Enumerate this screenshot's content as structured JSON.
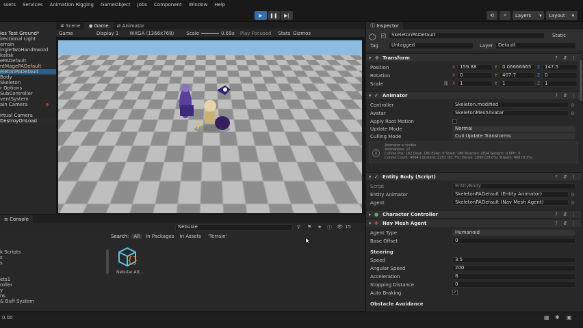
{
  "menu": [
    "ssets",
    "Services",
    "Animation Rigging",
    "GameObject",
    "Jobs",
    "Component",
    "Window",
    "Help"
  ],
  "toolbar": {
    "layers": "Layers",
    "layout": "Layout"
  },
  "scene_tabs": {
    "scene": "Scene",
    "game": "Game",
    "animator": "Animator"
  },
  "game_bar": {
    "mode": "Game",
    "display": "Display 1",
    "resolution": "WXGA (1366x768)",
    "scale_label": "Scale",
    "scale_value": "0.69x",
    "play_focused": "Play Focused",
    "stats": "Stats",
    "gizmos": "Gizmos"
  },
  "hierarchy": {
    "scene_name": "ies Test Ground*",
    "items": [
      "irectional Light",
      "errain",
      "ingleTwoHandSword",
      "kalisk",
      "ePADefault",
      "ntMagePADefault",
      "eletonPADefault",
      "Body",
      "Skeleton",
      "r Options",
      "SubController",
      "ventSystem",
      "ain Camera",
      "",
      "irtual Camera",
      "DestroyOnLoad"
    ]
  },
  "project": {
    "tab": "Console",
    "search_label": "Search:",
    "filters": [
      "All",
      "In Packages",
      "In Assets",
      "'Terrain'"
    ],
    "search_value": "Nebulae",
    "asset_label": "Nebular Att...",
    "sidebar": [
      "",
      "",
      "",
      "k Scripts",
      "s",
      "s",
      "",
      "",
      "ets1",
      "roller",
      "y",
      "ns",
      "& Buff System"
    ],
    "count": "15"
  },
  "status": {
    "left": "0.00"
  },
  "inspector": {
    "tab": "Inspector",
    "object_name": "SkeletonPADefault",
    "static": "Static",
    "tag_label": "Tag",
    "tag_value": "Untagged",
    "layer_label": "Layer",
    "layer_value": "Default",
    "transform": {
      "title": "Transform",
      "position_label": "Position",
      "px": "159.88",
      "py": "0.06666665",
      "pz": "147.5",
      "rotation_label": "Rotation",
      "rx": "0",
      "ry": "407.7",
      "rz": "0",
      "scale_label": "Scale",
      "sx": "1",
      "sy": "1",
      "sz": "1"
    },
    "animator": {
      "title": "Animator",
      "controller_label": "Controller",
      "controller_value": "Skeleton.modified",
      "avatar_label": "Avatar",
      "avatar_value": "SkeletonMeshAvatar",
      "root_motion_label": "Apply Root Motion",
      "update_mode_label": "Update Mode",
      "update_mode_value": "Normal",
      "culling_label": "Culling Mode",
      "culling_value": "Cull Update Transforms",
      "info1": "Animator is visible",
      "info2": "Animations: 15",
      "info3": "Curves Pos: 182 Quat: 180 Euler: 0 Scale: 180 Muscles: 2824 Generic: 0 PPtr: 0",
      "info4": "Curves Count: 4004 Constant: 2201 (81.7%) Dense: 1890 (28.0%) Stream: 468 (9.3%)"
    },
    "entity_body": {
      "title": "Entity Body (Script)",
      "script_label": "Script",
      "script_value": "EntityBody",
      "entity_animator_label": "Entity Animator",
      "entity_animator_value": "SkeletonPADefault (Entity Animator)",
      "agent_label": "Agent",
      "agent_value": "SkeletonPADefault (Nav Mesh Agent)"
    },
    "character_controller": {
      "title": "Character Controller"
    },
    "nav_mesh": {
      "title": "Nav Mesh Agent",
      "agent_type_label": "Agent Type",
      "agent_type_value": "Humanoid",
      "base_offset_label": "Base Offset",
      "base_offset_value": "0",
      "steering_label": "Steering",
      "speed_label": "Speed",
      "speed_value": "3.5",
      "angular_label": "Angular Speed",
      "angular_value": "200",
      "accel_label": "Acceleration",
      "accel_value": "8",
      "stop_label": "Stopping Distance",
      "stop_value": "0",
      "brake_label": "Auto Braking",
      "avoid_label": "Obstacle Avoidance"
    }
  },
  "colors": {
    "accent": "#2c5d87",
    "play_button": "#2d6fb3",
    "panel": "#282828",
    "menubar": "#191919"
  }
}
